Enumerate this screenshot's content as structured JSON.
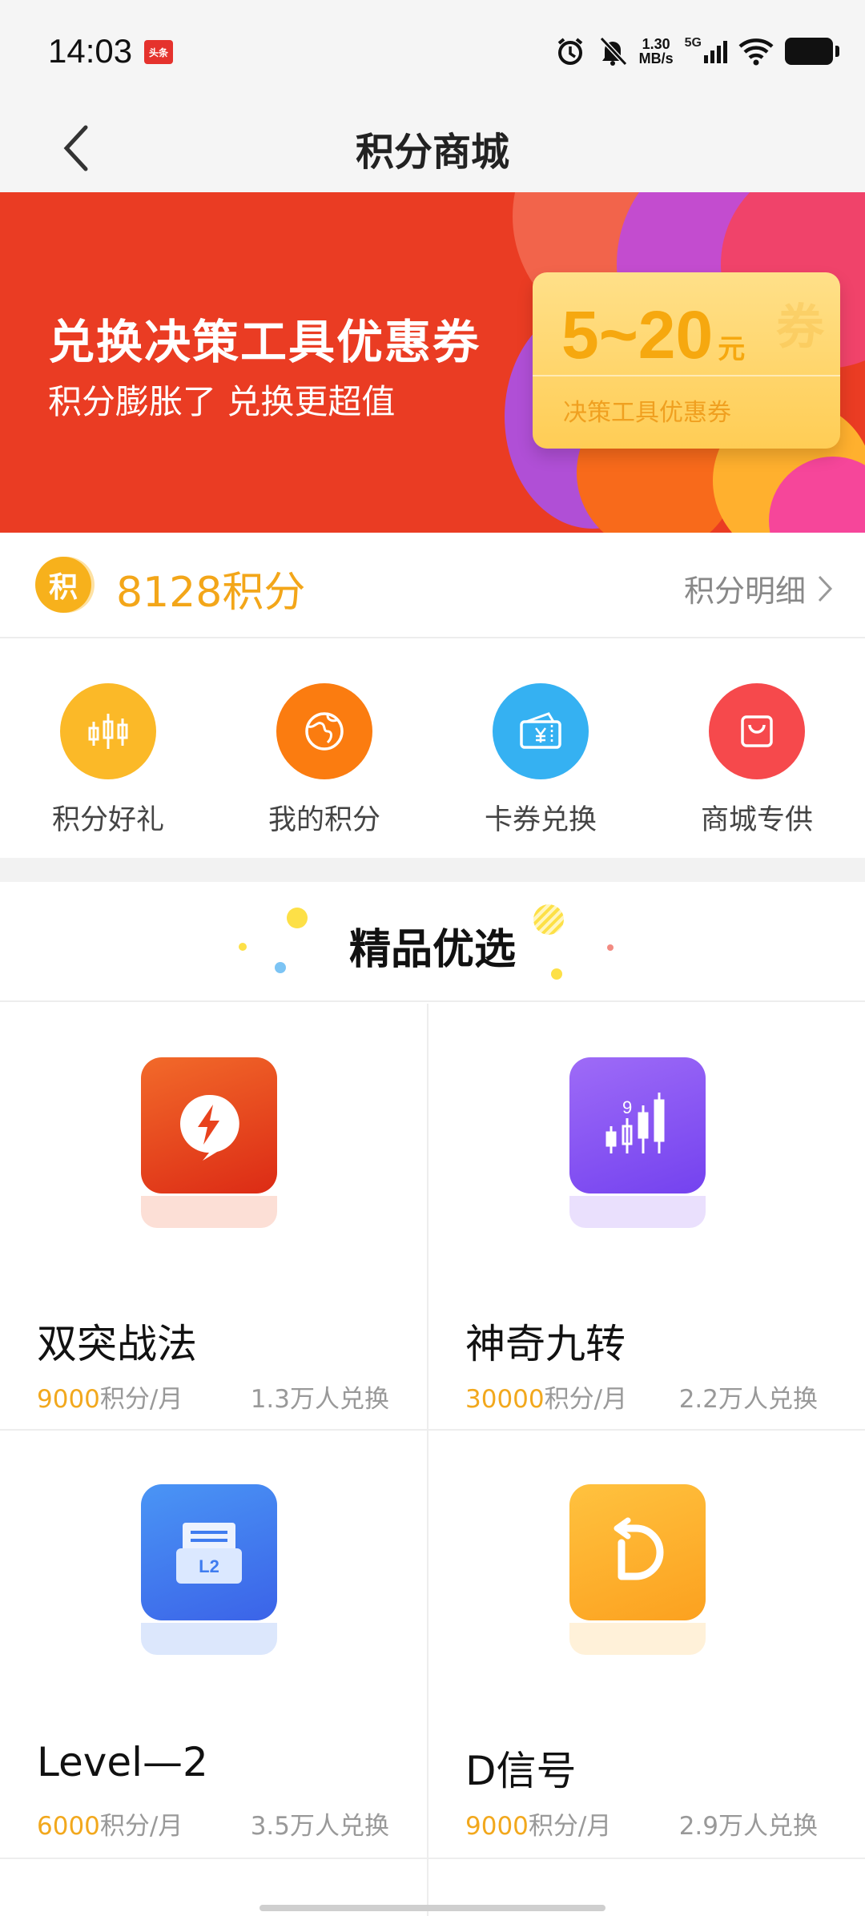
{
  "status_bar": {
    "time": "14:03",
    "app_badge": "头条",
    "net_speed_value": "1.30",
    "net_speed_unit": "MB/s",
    "network": "5G"
  },
  "nav": {
    "title": "积分商城"
  },
  "banner": {
    "title": "兑换决策工具优惠券",
    "subtitle": "积分膨胀了 兑换更超值",
    "coupon_amount": "5~20",
    "coupon_unit": "元",
    "coupon_name": "决策工具优惠券",
    "coupon_watermark": "券"
  },
  "points": {
    "icon_char": "积",
    "value": "8128积分",
    "detail_label": "积分明细"
  },
  "shortcuts": [
    {
      "label": "积分好礼",
      "color": "#fbb928"
    },
    {
      "label": "我的积分",
      "color": "#fb7c10"
    },
    {
      "label": "卡券兑换",
      "color": "#35b1f2"
    },
    {
      "label": "商城专供",
      "color": "#f6494c"
    }
  ],
  "section": {
    "title": "精品优选"
  },
  "products": [
    {
      "name": "双突战法",
      "price": "9000",
      "unit": "积分/月",
      "count": "1.3万人兑换",
      "icon": "lightning-chat-icon",
      "color": "#ee4b1d"
    },
    {
      "name": "神奇九转",
      "price": "30000",
      "unit": "积分/月",
      "count": "2.2万人兑换",
      "icon": "candlestick-9-icon",
      "color": "#8a55f5",
      "icon_text": "9"
    },
    {
      "name": "Level—2",
      "price": "6000",
      "unit": "积分/月",
      "count": "3.5万人兑换",
      "icon": "l2-document-icon",
      "color": "#3f7cf0",
      "icon_text": "L2"
    },
    {
      "name": "D信号",
      "price": "9000",
      "unit": "积分/月",
      "count": "2.9万人兑换",
      "icon": "d-signal-icon",
      "color": "#fdb12e"
    }
  ]
}
